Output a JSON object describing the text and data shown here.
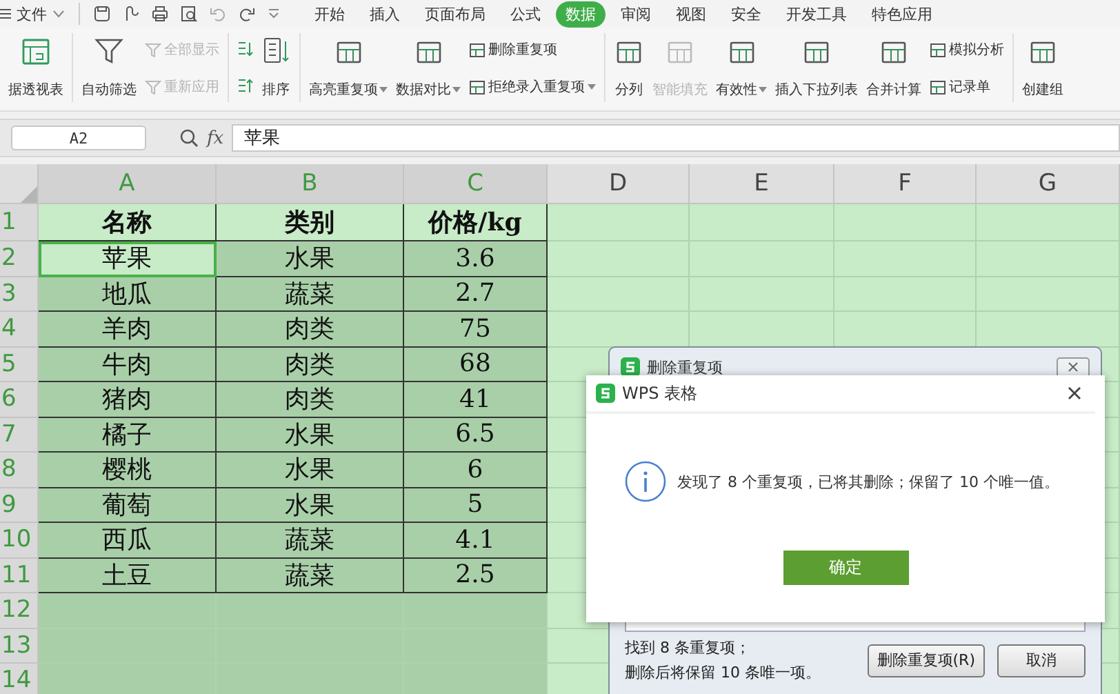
{
  "menu_bar": {
    "file_label": "文件",
    "tabs": [
      {
        "label": "开始",
        "selected": false
      },
      {
        "label": "插入",
        "selected": false
      },
      {
        "label": "页面布局",
        "selected": false
      },
      {
        "label": "公式",
        "selected": false
      },
      {
        "label": "数据",
        "selected": true
      },
      {
        "label": "审阅",
        "selected": false
      },
      {
        "label": "视图",
        "selected": false
      },
      {
        "label": "安全",
        "selected": false
      },
      {
        "label": "开发工具",
        "selected": false
      },
      {
        "label": "特色应用",
        "selected": false
      }
    ]
  },
  "ribbon": {
    "groups": [
      {
        "items": [
          {
            "label": "据透视表",
            "kind": "large",
            "disabled": false,
            "dropdown": false
          }
        ]
      },
      {
        "items": [
          {
            "label": "自动筛选",
            "kind": "large",
            "disabled": false,
            "dropdown": false
          },
          {
            "label": "全部显示",
            "kind": "small",
            "disabled": true,
            "dropdown": false
          },
          {
            "label": "重新应用",
            "kind": "small",
            "disabled": true,
            "dropdown": false
          }
        ]
      },
      {
        "items": [
          {
            "kind": "icon",
            "disabled": false,
            "dropdown": false
          },
          {
            "kind": "icon",
            "disabled": false,
            "dropdown": false
          },
          {
            "label": "排序",
            "kind": "large",
            "disabled": false,
            "dropdown": false
          }
        ]
      },
      {
        "items": [
          {
            "label": "高亮重复项",
            "kind": "large",
            "disabled": false,
            "dropdown": true
          },
          {
            "label": "数据对比",
            "kind": "large",
            "disabled": false,
            "dropdown": true
          },
          {
            "label": "删除重复项",
            "kind": "small",
            "disabled": false,
            "dropdown": false
          },
          {
            "label": "拒绝录入重复项",
            "kind": "small",
            "disabled": false,
            "dropdown": true
          }
        ]
      },
      {
        "items": [
          {
            "label": "分列",
            "kind": "large",
            "disabled": false,
            "dropdown": false
          },
          {
            "label": "智能填充",
            "kind": "large",
            "disabled": true,
            "dropdown": false
          },
          {
            "label": "有效性",
            "kind": "large",
            "disabled": false,
            "dropdown": true
          },
          {
            "label": "插入下拉列表",
            "kind": "large",
            "disabled": false,
            "dropdown": false
          },
          {
            "label": "合并计算",
            "kind": "large",
            "disabled": false,
            "dropdown": false
          },
          {
            "label": "模拟分析",
            "kind": "small",
            "disabled": false,
            "dropdown": false
          },
          {
            "label": "记录单",
            "kind": "small",
            "disabled": false,
            "dropdown": false
          }
        ]
      },
      {
        "items": [
          {
            "label": "创建组",
            "kind": "large",
            "disabled": false,
            "dropdown": false
          }
        ]
      }
    ]
  },
  "formula_bar": {
    "name_box": "A2",
    "fx_label": "fx",
    "value": "苹果"
  },
  "sheet": {
    "columns": [
      {
        "label": "A",
        "selected": true
      },
      {
        "label": "B",
        "selected": true
      },
      {
        "label": "C",
        "selected": true
      },
      {
        "label": "D",
        "selected": false
      },
      {
        "label": "E",
        "selected": false
      },
      {
        "label": "F",
        "selected": false
      },
      {
        "label": "G",
        "selected": false
      }
    ],
    "rows": [
      {
        "number": "1",
        "kind": "header",
        "cells": [
          {
            "text": "名称",
            "active": false
          },
          {
            "text": "类别",
            "active": false
          },
          {
            "text": "价格/kg",
            "active": false
          }
        ]
      },
      {
        "number": "2",
        "kind": "data",
        "cells": [
          {
            "text": "苹果",
            "active": true
          },
          {
            "text": "水果",
            "active": false
          },
          {
            "text": "3.6",
            "active": false
          }
        ]
      },
      {
        "number": "3",
        "kind": "data",
        "cells": [
          {
            "text": "地瓜",
            "active": false
          },
          {
            "text": "蔬菜",
            "active": false
          },
          {
            "text": "2.7",
            "active": false
          }
        ]
      },
      {
        "number": "4",
        "kind": "data",
        "cells": [
          {
            "text": "羊肉",
            "active": false
          },
          {
            "text": "肉类",
            "active": false
          },
          {
            "text": "75",
            "active": false
          }
        ]
      },
      {
        "number": "5",
        "kind": "data",
        "cells": [
          {
            "text": "牛肉",
            "active": false
          },
          {
            "text": "肉类",
            "active": false
          },
          {
            "text": "68",
            "active": false
          }
        ]
      },
      {
        "number": "6",
        "kind": "data",
        "cells": [
          {
            "text": "猪肉",
            "active": false
          },
          {
            "text": "肉类",
            "active": false
          },
          {
            "text": "41",
            "active": false
          }
        ]
      },
      {
        "number": "7",
        "kind": "data",
        "cells": [
          {
            "text": "橘子",
            "active": false
          },
          {
            "text": "水果",
            "active": false
          },
          {
            "text": "6.5",
            "active": false
          }
        ]
      },
      {
        "number": "8",
        "kind": "data",
        "cells": [
          {
            "text": "樱桃",
            "active": false
          },
          {
            "text": "水果",
            "active": false
          },
          {
            "text": "6",
            "active": false
          }
        ]
      },
      {
        "number": "9",
        "kind": "data",
        "cells": [
          {
            "text": "葡萄",
            "active": false
          },
          {
            "text": "水果",
            "active": false
          },
          {
            "text": "5",
            "active": false
          }
        ]
      },
      {
        "number": "10",
        "kind": "data",
        "cells": [
          {
            "text": "西瓜",
            "active": false
          },
          {
            "text": "蔬菜",
            "active": false
          },
          {
            "text": "4.1",
            "active": false
          }
        ]
      },
      {
        "number": "11",
        "kind": "data",
        "cells": [
          {
            "text": "土豆",
            "active": false
          },
          {
            "text": "蔬菜",
            "active": false
          },
          {
            "text": "2.5",
            "active": false
          }
        ]
      },
      {
        "number": "12",
        "kind": "empty"
      },
      {
        "number": "13",
        "kind": "empty"
      },
      {
        "number": "14",
        "kind": "empty"
      }
    ]
  },
  "remove_duplicates_dialog": {
    "title": "删除重复项",
    "summary_lines": [
      "找到 8 条重复项；",
      "删除后将保留 10 条唯一项。"
    ],
    "buttons": [
      {
        "label": "删除重复项(R)",
        "kind": "primary"
      },
      {
        "label": "取消",
        "kind": "cancel"
      }
    ]
  },
  "message_dialog": {
    "title": "WPS 表格",
    "message": "发现了 8 个重复项，已将其删除；保留了 10 个唯一值。",
    "button": "确定"
  }
}
